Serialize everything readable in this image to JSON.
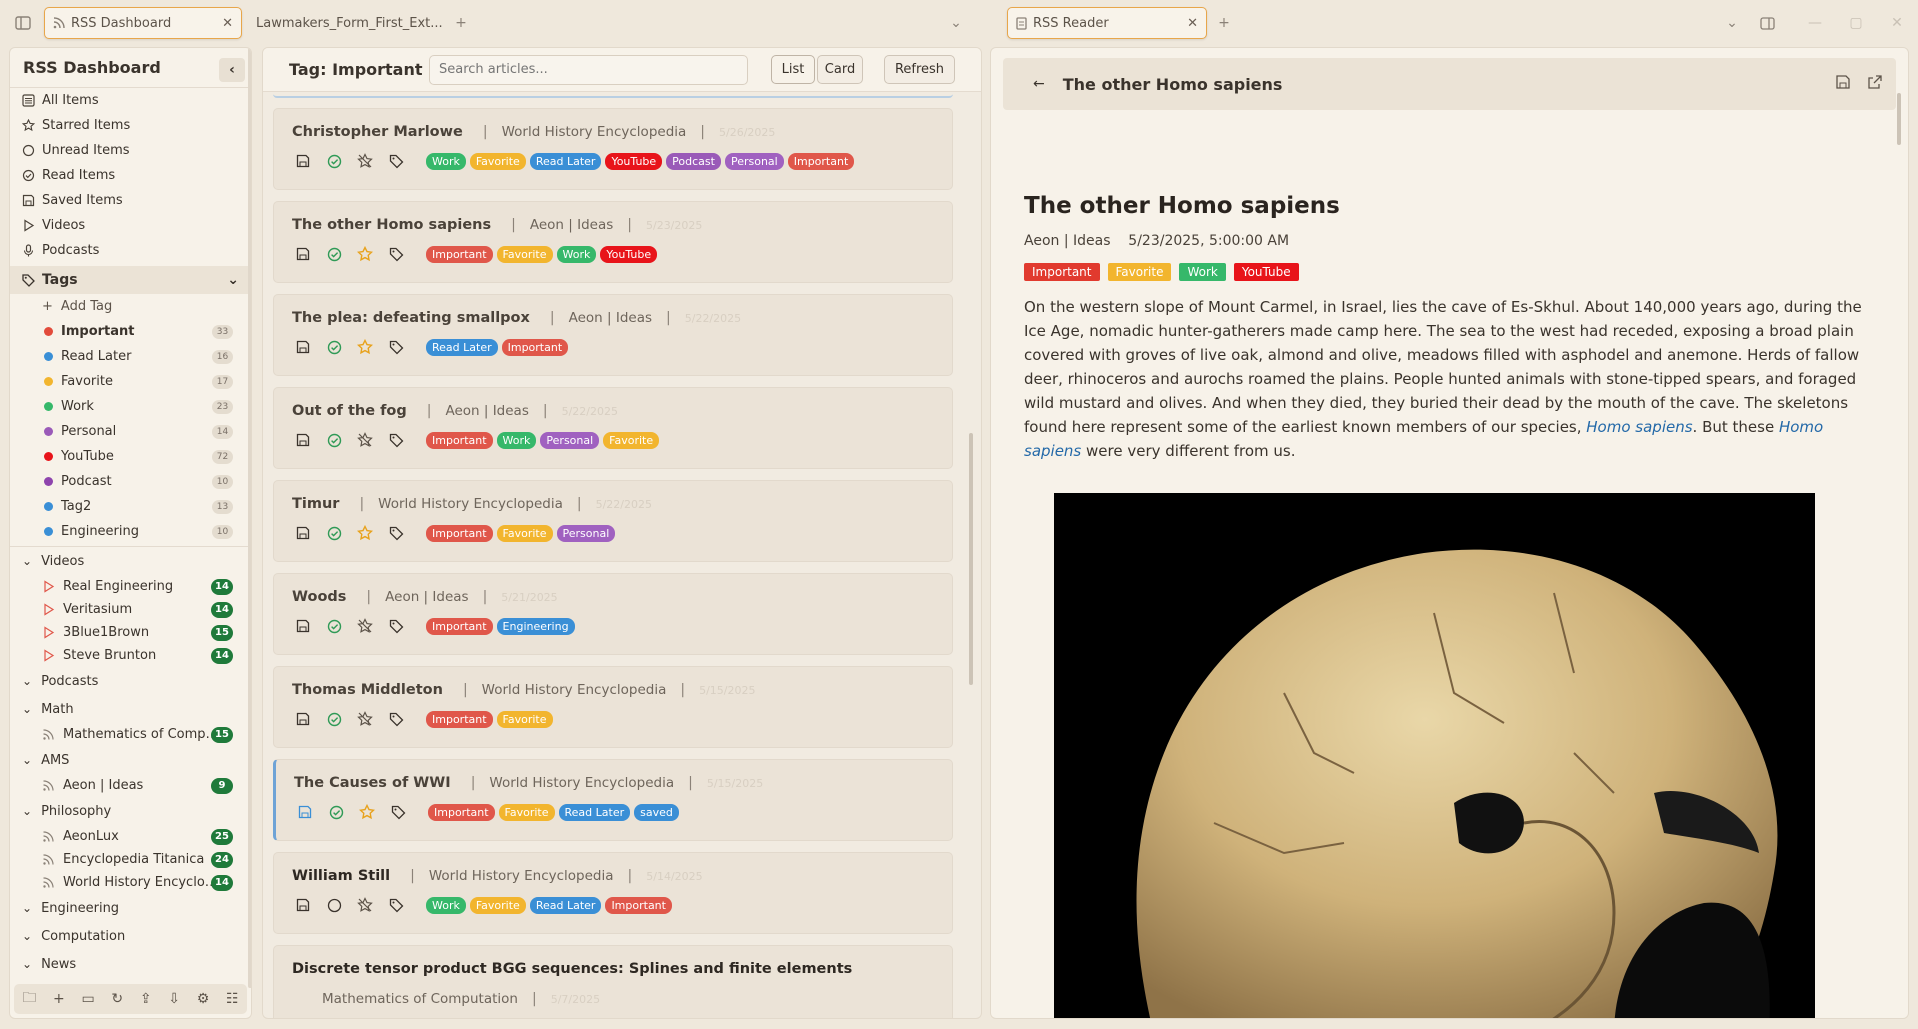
{
  "tabs_left": [
    {
      "label": "RSS Dashboard",
      "active": true
    },
    {
      "label": "Lawmakers_Form_First_Ext...",
      "active": false
    }
  ],
  "tabs_right": [
    {
      "label": "RSS Reader",
      "active": true
    }
  ],
  "sidebar": {
    "title": "RSS Dashboard",
    "nav": [
      {
        "label": "All Items",
        "icon": "list-icon"
      },
      {
        "label": "Starred Items",
        "icon": "star-icon"
      },
      {
        "label": "Unread Items",
        "icon": "circle-icon"
      },
      {
        "label": "Read Items",
        "icon": "check-circle-icon"
      },
      {
        "label": "Saved Items",
        "icon": "save-icon"
      },
      {
        "label": "Videos",
        "icon": "play-icon"
      },
      {
        "label": "Podcasts",
        "icon": "mic-icon"
      }
    ],
    "tags_header": "Tags",
    "add_tag": "Add Tag",
    "tags": [
      {
        "label": "Important",
        "count": "33",
        "color": "#e24b3b",
        "bold": true
      },
      {
        "label": "Read Later",
        "count": "16",
        "color": "#3a8fd6"
      },
      {
        "label": "Favorite",
        "count": "17",
        "color": "#f2b52e"
      },
      {
        "label": "Work",
        "count": "23",
        "color": "#36b86a"
      },
      {
        "label": "Personal",
        "count": "14",
        "color": "#9a5ab8"
      },
      {
        "label": "YouTube",
        "count": "72",
        "color": "#e8141a"
      },
      {
        "label": "Podcast",
        "count": "10",
        "color": "#8e44ad"
      },
      {
        "label": "Tag2",
        "count": "13",
        "color": "#3a8fd6"
      },
      {
        "label": "Engineering",
        "count": "10",
        "color": "#3a8fd6"
      }
    ],
    "groups": [
      {
        "label": "Videos",
        "feeds": [
          {
            "label": "Real Engineering",
            "count": "14",
            "icon": "play-icon"
          },
          {
            "label": "Veritasium",
            "count": "14",
            "icon": "play-icon"
          },
          {
            "label": "3Blue1Brown",
            "count": "15",
            "icon": "play-icon"
          },
          {
            "label": "Steve Brunton",
            "count": "14",
            "icon": "play-icon"
          }
        ]
      },
      {
        "label": "Podcasts",
        "feeds": []
      },
      {
        "label": "Math",
        "feeds": [
          {
            "label": "Mathematics of Computation",
            "count": "15",
            "icon": "rss-icon"
          }
        ]
      },
      {
        "label": "AMS",
        "feeds": [
          {
            "label": "Aeon | Ideas",
            "count": "9",
            "icon": "rss-icon"
          }
        ]
      },
      {
        "label": "Philosophy",
        "feeds": [
          {
            "label": "AeonLux",
            "count": "25",
            "icon": "rss-icon"
          },
          {
            "label": "Encyclopedia Titanica",
            "count": "24",
            "icon": "rss-icon"
          },
          {
            "label": "World History Encyclopedia",
            "count": "14",
            "icon": "rss-icon"
          }
        ]
      },
      {
        "label": "Engineering",
        "feeds": []
      },
      {
        "label": "Computation",
        "feeds": []
      },
      {
        "label": "News",
        "feeds": []
      }
    ]
  },
  "list": {
    "title": "Tag: Important",
    "search_placeholder": "Search articles...",
    "btn_list": "List",
    "btn_card": "Card",
    "btn_refresh": "Refresh",
    "articles": [
      {
        "title": "Christopher Marlowe",
        "source": "World History Encyclopedia",
        "date": "5/26/2025",
        "starred": false,
        "read": true,
        "unread": false,
        "selected": false,
        "tags": [
          "Work",
          "Favorite",
          "Read Later",
          "YouTube",
          "Podcast",
          "Personal",
          "Important"
        ]
      },
      {
        "title": "The other Homo sapiens",
        "source": "Aeon | Ideas",
        "date": "5/23/2025",
        "starred": true,
        "read": true,
        "unread": false,
        "selected": false,
        "tags": [
          "Important",
          "Favorite",
          "Work",
          "YouTube"
        ]
      },
      {
        "title": "The plea: defeating smallpox",
        "source": "Aeon | Ideas",
        "date": "5/22/2025",
        "starred": true,
        "read": true,
        "unread": false,
        "selected": false,
        "tags": [
          "Read Later",
          "Important"
        ]
      },
      {
        "title": "Out of the fog",
        "source": "Aeon | Ideas",
        "date": "5/22/2025",
        "starred": false,
        "read": true,
        "unread": false,
        "selected": false,
        "tags": [
          "Important",
          "Work",
          "Personal",
          "Favorite"
        ]
      },
      {
        "title": "Timur",
        "source": "World History Encyclopedia",
        "date": "5/22/2025",
        "starred": true,
        "read": true,
        "unread": false,
        "selected": false,
        "tags": [
          "Important",
          "Favorite",
          "Personal"
        ]
      },
      {
        "title": "Woods",
        "source": "Aeon | Ideas",
        "date": "5/21/2025",
        "starred": false,
        "read": true,
        "unread": false,
        "selected": false,
        "tags": [
          "Important",
          "Engineering"
        ]
      },
      {
        "title": "Thomas Middleton",
        "source": "World History Encyclopedia",
        "date": "5/15/2025",
        "starred": false,
        "read": true,
        "unread": false,
        "selected": false,
        "tags": [
          "Important",
          "Favorite"
        ]
      },
      {
        "title": "The Causes of WWI",
        "source": "World History Encyclopedia",
        "date": "5/15/2025",
        "starred": true,
        "read": true,
        "unread": false,
        "selected": true,
        "tags": [
          "Important",
          "Favorite",
          "Read Later",
          "saved"
        ]
      },
      {
        "title": "William Still",
        "source": "World History Encyclopedia",
        "date": "5/14/2025",
        "starred": false,
        "read": false,
        "unread": true,
        "selected": false,
        "tags": [
          "Work",
          "Favorite",
          "Read Later",
          "Important"
        ]
      }
    ],
    "last_title": "Discrete tensor product BGG sequences: Splines and finite elements",
    "last_source": "Mathematics of Computation",
    "last_date": "5/7/2025"
  },
  "tag_colors": {
    "Work": "#36b86a",
    "Favorite": "#f2b52e",
    "Read Later": "#3a8fd6",
    "YouTube": "#e8141a",
    "Podcast": "#9a5ab8",
    "Personal": "#a061c0",
    "Important": "#e0574a",
    "Engineering": "#3a8fd6",
    "saved": "#3a8fd6"
  },
  "reader": {
    "header_title": "The other Homo sapiens",
    "title": "The other Homo sapiens",
    "meta": "Aeon | Ideas    5/23/2025, 5:00:00 AM",
    "tags": [
      {
        "label": "Important",
        "color": "#e13a2e"
      },
      {
        "label": "Favorite",
        "color": "#f2b52e"
      },
      {
        "label": "Work",
        "color": "#36b86a"
      },
      {
        "label": "YouTube",
        "color": "#e8141a"
      }
    ],
    "body_pre": "On the western slope of Mount Carmel, in Israel, lies the cave of Es-Skhul. About 140,000 years ago, during the Ice Age, nomadic hunter-gatherers made camp here. The sea to the west had receded, exposing a broad plain covered with groves of live oak, almond and olive, meadows filled with asphodel and anemone. Herds of fallow deer, rhinoceros and aurochs roamed the plains. People hunted animals with stone-tipped spears, and foraged wild mustard and olives. And when they died, they buried their dead by the mouth of the cave. The skeletons found here represent some of the earliest known members of our species, ",
    "link1": "Homo sapiens",
    "body_mid": ". But these ",
    "link2": "Homo sapiens",
    "body_post": " were very different from us."
  }
}
